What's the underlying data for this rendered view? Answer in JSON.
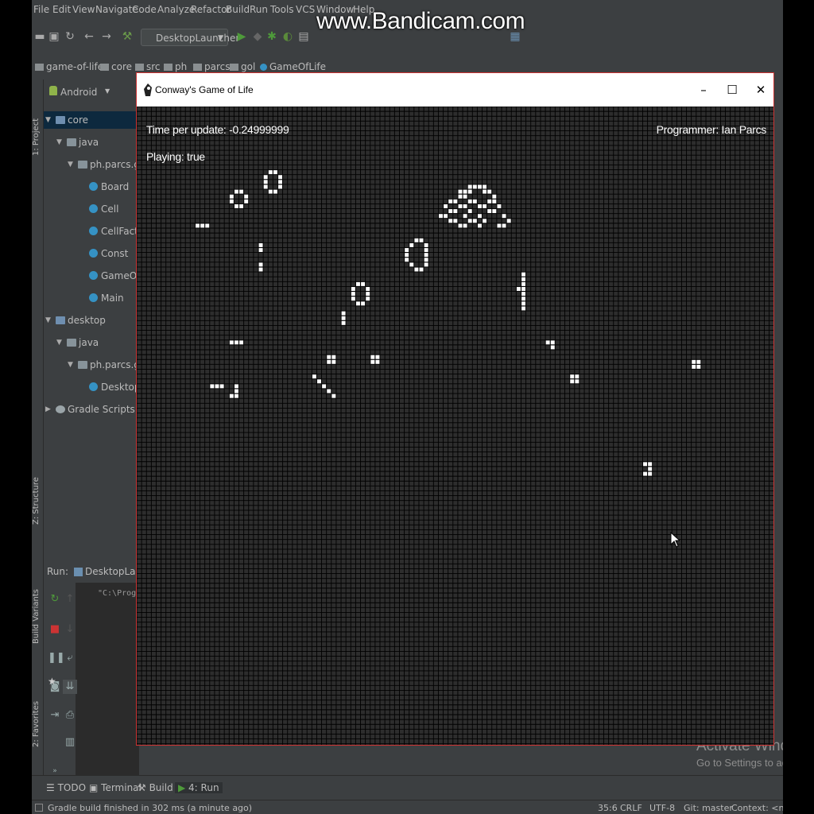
{
  "menu": [
    "File",
    "Edit",
    "View",
    "Navigate",
    "Code",
    "Analyze",
    "Refactor",
    "Build",
    "Run",
    "Tools",
    "VCS",
    "Window",
    "Help"
  ],
  "watermark": "www.Bandicam.com",
  "toolbar": {
    "run_config": "DesktopLauncher"
  },
  "breadcrumb": [
    "game-of-life",
    "core",
    "src",
    "ph",
    "parcs",
    "gol",
    "GameOfLife"
  ],
  "project": {
    "view_label": "Android",
    "tree": [
      {
        "label": "core",
        "type": "module",
        "selected": true
      },
      {
        "label": "java",
        "type": "folder"
      },
      {
        "label": "ph.parcs.gol",
        "type": "package"
      },
      {
        "label": "Board",
        "type": "class"
      },
      {
        "label": "Cell",
        "type": "class"
      },
      {
        "label": "CellFactory",
        "type": "class"
      },
      {
        "label": "Const",
        "type": "class"
      },
      {
        "label": "GameOfLife",
        "type": "class"
      },
      {
        "label": "Main",
        "type": "class"
      },
      {
        "label": "desktop",
        "type": "module"
      },
      {
        "label": "java",
        "type": "folder"
      },
      {
        "label": "ph.parcs.gol.d",
        "type": "package"
      },
      {
        "label": "DesktopLau",
        "type": "class"
      },
      {
        "label": "Gradle Scripts",
        "type": "gradle"
      }
    ]
  },
  "side_tabs": {
    "project": "1: Project",
    "structure": "Z: Structure",
    "build_variants": "Build Variants",
    "favorites": "2: Favorites"
  },
  "run_panel": {
    "label": "Run:",
    "config": "DesktopLaunch",
    "console": "\"C:\\Program"
  },
  "bottom_tabs": [
    "TODO",
    "Terminal",
    "Build",
    "4: Run"
  ],
  "status": {
    "message": "Gradle build finished in 302 ms (a minute ago)",
    "position": "35:6",
    "line_sep": "CRLF",
    "encoding": "UTF-8",
    "git": "Git: master",
    "context": "Context: <no cc"
  },
  "activate": {
    "title": "Activate Window",
    "subtitle": "Go to Settings to act"
  },
  "game_window": {
    "title": "Conway's Game of Life",
    "time_per_update": "Time per update: -0.24999999",
    "playing": "Playing: true",
    "programmer": "Programmer: Ian Parcs"
  },
  "colors": {
    "ide_bg": "#3c3f41",
    "editor_bg": "#2b2b2b",
    "grid_bg": "#2d2d2d",
    "cell_alive": "#ffffff",
    "selection": "#0d293e",
    "accent_red": "#cc3333"
  },
  "board": {
    "alive_cells": [
      [
        68,
        16
      ],
      [
        69,
        16
      ],
      [
        70,
        16
      ],
      [
        71,
        16
      ],
      [
        66,
        17
      ],
      [
        67,
        17
      ],
      [
        68,
        17
      ],
      [
        71,
        17
      ],
      [
        72,
        17
      ],
      [
        66,
        18
      ],
      [
        67,
        18
      ],
      [
        73,
        18
      ],
      [
        64,
        19
      ],
      [
        65,
        19
      ],
      [
        68,
        19
      ],
      [
        69,
        19
      ],
      [
        72,
        19
      ],
      [
        73,
        19
      ],
      [
        63,
        20
      ],
      [
        66,
        20
      ],
      [
        67,
        20
      ],
      [
        70,
        20
      ],
      [
        71,
        20
      ],
      [
        74,
        20
      ],
      [
        64,
        21
      ],
      [
        65,
        21
      ],
      [
        68,
        21
      ],
      [
        72,
        21
      ],
      [
        73,
        21
      ],
      [
        62,
        22
      ],
      [
        63,
        22
      ],
      [
        67,
        22
      ],
      [
        70,
        22
      ],
      [
        75,
        22
      ],
      [
        64,
        23
      ],
      [
        65,
        23
      ],
      [
        68,
        23
      ],
      [
        69,
        23
      ],
      [
        71,
        23
      ],
      [
        76,
        23
      ],
      [
        66,
        24
      ],
      [
        67,
        24
      ],
      [
        70,
        24
      ],
      [
        74,
        24
      ],
      [
        75,
        24
      ],
      [
        12,
        24
      ],
      [
        13,
        24
      ],
      [
        14,
        24
      ],
      [
        20,
        17
      ],
      [
        21,
        17
      ],
      [
        19,
        18
      ],
      [
        22,
        18
      ],
      [
        19,
        19
      ],
      [
        22,
        19
      ],
      [
        20,
        20
      ],
      [
        21,
        20
      ],
      [
        27,
        13
      ],
      [
        28,
        13
      ],
      [
        26,
        14
      ],
      [
        29,
        14
      ],
      [
        26,
        15
      ],
      [
        29,
        15
      ],
      [
        26,
        16
      ],
      [
        29,
        16
      ],
      [
        27,
        17
      ],
      [
        28,
        17
      ],
      [
        57,
        27
      ],
      [
        58,
        27
      ],
      [
        56,
        28
      ],
      [
        59,
        28
      ],
      [
        55,
        29
      ],
      [
        59,
        29
      ],
      [
        55,
        30
      ],
      [
        59,
        30
      ],
      [
        55,
        31
      ],
      [
        59,
        31
      ],
      [
        56,
        32
      ],
      [
        59,
        32
      ],
      [
        57,
        33
      ],
      [
        58,
        33
      ],
      [
        25,
        28
      ],
      [
        25,
        29
      ],
      [
        25,
        32
      ],
      [
        25,
        33
      ],
      [
        45,
        36
      ],
      [
        46,
        36
      ],
      [
        44,
        37
      ],
      [
        47,
        37
      ],
      [
        44,
        38
      ],
      [
        47,
        38
      ],
      [
        44,
        39
      ],
      [
        47,
        39
      ],
      [
        45,
        40
      ],
      [
        46,
        40
      ],
      [
        42,
        42
      ],
      [
        42,
        43
      ],
      [
        42,
        44
      ],
      [
        19,
        48
      ],
      [
        20,
        48
      ],
      [
        21,
        48
      ],
      [
        39,
        51
      ],
      [
        40,
        51
      ],
      [
        48,
        51
      ],
      [
        49,
        51
      ],
      [
        39,
        52
      ],
      [
        40,
        52
      ],
      [
        48,
        52
      ],
      [
        49,
        52
      ],
      [
        20,
        57
      ],
      [
        20,
        58
      ],
      [
        19,
        59
      ],
      [
        20,
        59
      ],
      [
        36,
        55
      ],
      [
        37,
        56
      ],
      [
        38,
        57
      ],
      [
        39,
        58
      ],
      [
        40,
        59
      ],
      [
        79,
        34
      ],
      [
        79,
        35
      ],
      [
        79,
        36
      ],
      [
        78,
        37
      ],
      [
        79,
        37
      ],
      [
        79,
        38
      ],
      [
        79,
        39
      ],
      [
        79,
        40
      ],
      [
        79,
        41
      ],
      [
        84,
        48
      ],
      [
        85,
        48
      ],
      [
        85,
        49
      ],
      [
        89,
        55
      ],
      [
        90,
        55
      ],
      [
        89,
        56
      ],
      [
        90,
        56
      ],
      [
        114,
        52
      ],
      [
        115,
        52
      ],
      [
        114,
        53
      ],
      [
        115,
        53
      ],
      [
        104,
        73
      ],
      [
        105,
        73
      ],
      [
        105,
        74
      ],
      [
        104,
        75
      ],
      [
        105,
        75
      ],
      [
        15,
        57
      ],
      [
        16,
        57
      ],
      [
        17,
        57
      ]
    ]
  }
}
